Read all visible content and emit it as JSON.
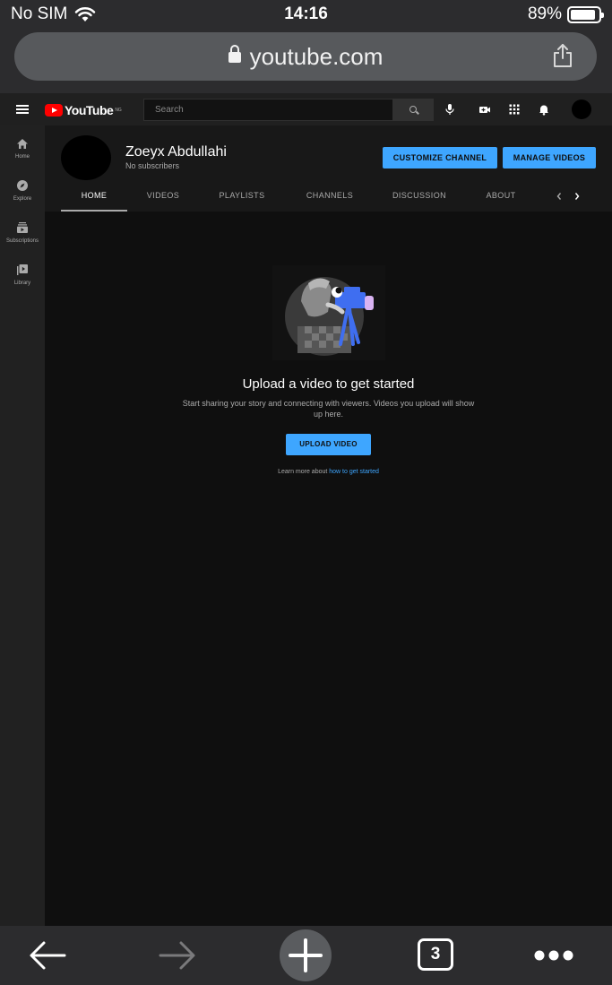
{
  "status": {
    "carrier": "No SIM",
    "time": "14:16",
    "battery_text": "89%",
    "battery_fraction": 0.89
  },
  "browser": {
    "url": "youtube.com",
    "tabs_count": "3"
  },
  "header": {
    "logo_text": "YouTube",
    "logo_country": "NG",
    "search_placeholder": "Search"
  },
  "sidebar": {
    "items": [
      {
        "label": "Home",
        "icon": "home-icon"
      },
      {
        "label": "Explore",
        "icon": "compass-icon"
      },
      {
        "label": "Subscriptions",
        "icon": "subscriptions-icon"
      },
      {
        "label": "Library",
        "icon": "library-icon"
      }
    ]
  },
  "channel": {
    "name": "Zoeyx Abdullahi",
    "subscribers": "No subscribers",
    "customize_label": "CUSTOMIZE CHANNEL",
    "manage_label": "MANAGE VIDEOS",
    "tabs": [
      "HOME",
      "VIDEOS",
      "PLAYLISTS",
      "CHANNELS",
      "DISCUSSION",
      "ABOUT"
    ],
    "active_tab": "HOME"
  },
  "empty_state": {
    "title": "Upload a video to get started",
    "description": "Start sharing your story and connecting with viewers. Videos you upload will show up here.",
    "upload_label": "UPLOAD VIDEO",
    "learn_prefix": "Learn more about ",
    "learn_link": "how to get started"
  },
  "colors": {
    "accent": "#3ea6ff",
    "brand_red": "#ff0000",
    "page_bg": "#0f0f0f"
  }
}
